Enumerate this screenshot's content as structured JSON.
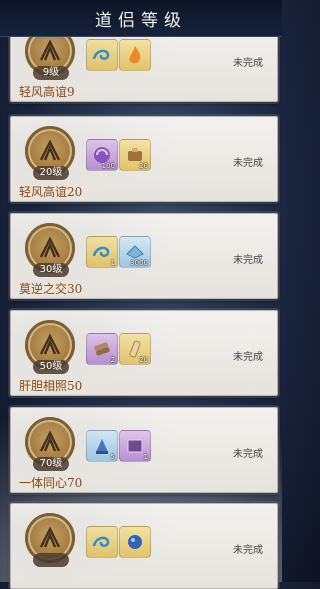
{
  "header": {
    "title": "道侣等级"
  },
  "rows": [
    {
      "level": "9级",
      "name": "轻风高谊9",
      "status": "未完成",
      "rewards": [
        {
          "icon": "wind-swirl-icon",
          "bg": "gold",
          "count": ""
        },
        {
          "icon": "flame-icon",
          "bg": "gold",
          "count": ""
        }
      ]
    },
    {
      "level": "20级",
      "name": "轻风高谊20",
      "status": "未完成",
      "rewards": [
        {
          "icon": "purple-orb-icon",
          "bg": "purple",
          "count": "100"
        },
        {
          "icon": "bundle-icon",
          "bg": "gold",
          "count": "20"
        }
      ]
    },
    {
      "level": "30级",
      "name": "莫逆之交30",
      "status": "未完成",
      "rewards": [
        {
          "icon": "wind-swirl-icon",
          "bg": "gold",
          "count": "1"
        },
        {
          "icon": "crystal-icon",
          "bg": "blue",
          "count": "3000"
        }
      ]
    },
    {
      "level": "50级",
      "name": "肝胆相照50",
      "status": "未完成",
      "rewards": [
        {
          "icon": "scroll-bundle-icon",
          "bg": "purple",
          "count": "2"
        },
        {
          "icon": "scroll-icon",
          "bg": "gold",
          "count": "20"
        }
      ]
    },
    {
      "level": "70级",
      "name": "一体同心70",
      "status": "未完成",
      "rewards": [
        {
          "icon": "lantern-icon",
          "bg": "blue",
          "count": "5"
        },
        {
          "icon": "box-icon",
          "bg": "purple",
          "count": "1"
        }
      ]
    },
    {
      "level": "",
      "name": "",
      "status": "未完成",
      "rewards": [
        {
          "icon": "wind-swirl-icon",
          "bg": "gold",
          "count": ""
        },
        {
          "icon": "blue-orb-icon",
          "bg": "gold",
          "count": ""
        }
      ]
    }
  ],
  "colors": {
    "name_text": "#8a4a12",
    "badge_gold": "#a5783a",
    "status_text": "#444444"
  }
}
